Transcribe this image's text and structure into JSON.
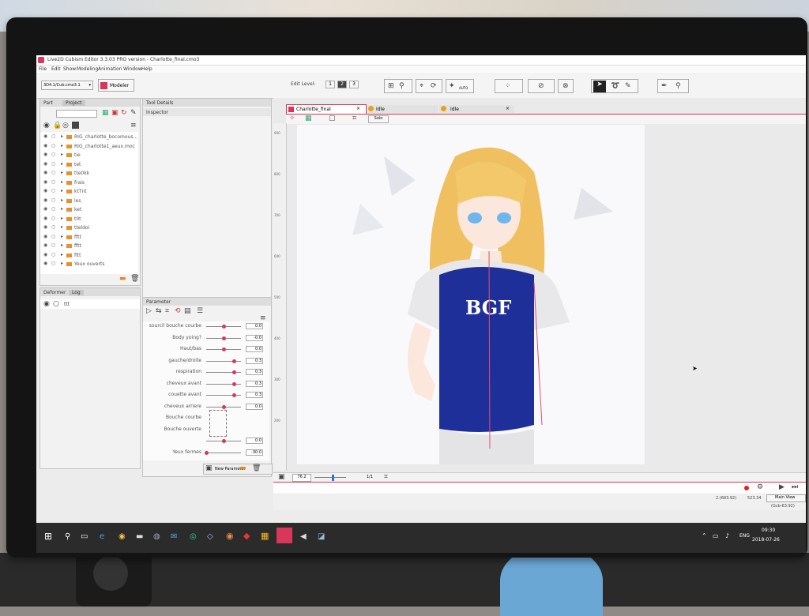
{
  "window": {
    "title": "Live2D Cubism Editor 3.3.03  PRO version - Charlotte_final.cmo3",
    "menu": [
      "File",
      "Edit",
      "Show",
      "Modeling",
      "Animation",
      "Window",
      "Help"
    ]
  },
  "toolbar": {
    "workspace_select": "3D4.1/Cub.cmo3.1",
    "modeler_label": "Modeler",
    "edit_level_label": "Edit Level:",
    "edit_levels": [
      "1",
      "2",
      "3"
    ],
    "auto_label": "AUTO"
  },
  "left_panel": {
    "tabs": [
      "Part",
      "Project"
    ],
    "layers": [
      "RIG_charlotte_bocomous...",
      "RIG_charlotte1_aeux.moc",
      "tie",
      "tet",
      "tte0kk",
      "frais",
      "ktTnt",
      "les",
      "ket",
      "t0t",
      "tteldoi",
      "fftt",
      "fftt",
      "fitt",
      "Yeux ouverts"
    ]
  },
  "deformer_panel": {
    "tabs": [
      "Deformer",
      "Log"
    ],
    "items": [
      "ttt"
    ]
  },
  "tool_details": {
    "tabs": [
      "Tool Details",
      "Inspector"
    ]
  },
  "parameters": {
    "tab": "Parameter",
    "items": [
      {
        "label": "sourcil bouche courbe",
        "value": "0.0"
      },
      {
        "label": "Body yoing?",
        "value": "-0.0"
      },
      {
        "label": "Haut/bas",
        "value": "0.0"
      },
      {
        "label": "gauche/droite",
        "value": "0.3"
      },
      {
        "label": "respiration",
        "value": "0.3"
      },
      {
        "label": "cheveux avant",
        "value": "0.3"
      },
      {
        "label": "couette avant",
        "value": "0.3"
      },
      {
        "label": "cheveux arriere",
        "value": "0.0"
      },
      {
        "label": "Bouche courbe",
        "value": ""
      },
      {
        "label": "Bouche ouverte",
        "value": ""
      },
      {
        "label": "",
        "value": "0.0"
      },
      {
        "label": "Yeux fermes",
        "value": "-30.0"
      }
    ],
    "footer_button": "New Parameter"
  },
  "canvas": {
    "tabs": [
      {
        "label": "Charlotte_final",
        "active": true
      },
      {
        "label": "Idle",
        "active": false
      },
      {
        "label": "Idle",
        "active": false
      }
    ],
    "solo_label": "Solo",
    "ruler_marks": [
      "900",
      "800",
      "700",
      "600",
      "500",
      "400",
      "300",
      "200"
    ],
    "shirt_text": "BGF",
    "zoom": "76.2",
    "page_indicator": "1/1"
  },
  "status": {
    "coords": "2.(683.92)",
    "coords2": "523.34",
    "view_mode": "Main View",
    "extra": "(Gcb-63.92)"
  },
  "taskbar": {
    "lang": "ENG",
    "time": "09:30",
    "date": "2018-07-26"
  },
  "colors": {
    "accent": "#d8365a",
    "shirt": "#1f2f9a",
    "hair": "#f0c060",
    "taskbar": "#2b2b2b"
  }
}
